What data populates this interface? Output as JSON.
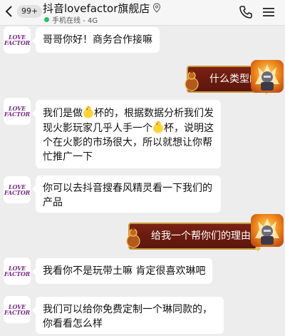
{
  "header": {
    "badge": "99+",
    "title": "抖音lovefactor旗舰店",
    "status": "手机在线 - 4G",
    "icons": [
      "back-arrow-icon",
      "location-pin-icon",
      "phone-icon",
      "menu-icon"
    ]
  },
  "contact": {
    "avatar_text_line1": "LOVE",
    "avatar_text_line2": "FACTOR"
  },
  "messages": [
    {
      "side": "in",
      "text": "哥哥你好！商务合作接嘛"
    },
    {
      "side": "out",
      "text": "什么类型的"
    },
    {
      "side": "in",
      "parts": [
        "我们是做",
        "杯的，根据数据分析我们发现火影玩家几乎人手一个",
        "杯，说明这个在火影的市场很大，所以就想让你帮忙推广一下"
      ]
    },
    {
      "side": "in",
      "text": "你可以去抖音搜春风精灵看一下我们的产品"
    },
    {
      "side": "out",
      "text": "给我一个帮你们的理由"
    },
    {
      "side": "in",
      "text": "我看你不是玩带土嘛 肯定很喜欢琳吧"
    },
    {
      "side": "in",
      "text": "我们可以给你免费定制一个琳同款的，你看看怎么样"
    }
  ],
  "colors": {
    "background": "#ededed",
    "bubble_in": "#ffffff",
    "bubble_out": "#6b1b10",
    "bubble_out_border": "#c79a3a",
    "online": "#22c55e",
    "avatar_logo": "#7b2a8a"
  }
}
